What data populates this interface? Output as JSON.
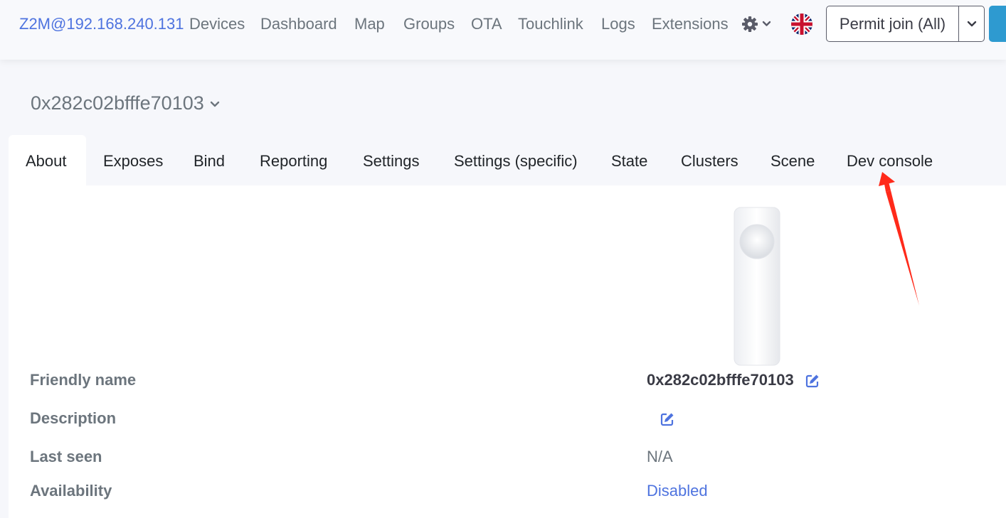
{
  "navbar": {
    "brand": "Z2M@192.168.240.131",
    "links": [
      "Devices",
      "Dashboard",
      "Map",
      "Groups",
      "OTA",
      "Touchlink",
      "Logs",
      "Extensions"
    ],
    "settings_icon": "gear-icon",
    "language_icon": "uk-flag-icon",
    "permit_join_label": "Permit join (All)",
    "brand_color": "#4e73df"
  },
  "device": {
    "title": "0x282c02bfffe70103"
  },
  "tabs": [
    "About",
    "Exposes",
    "Bind",
    "Reporting",
    "Settings",
    "Settings (specific)",
    "State",
    "Clusters",
    "Scene",
    "Dev console"
  ],
  "active_tab": "About",
  "about": {
    "rows": [
      {
        "label": "Friendly name",
        "value": "0x282c02bfffe70103"
      },
      {
        "label": "Description",
        "value": ""
      },
      {
        "label": "Last seen",
        "value": "N/A"
      },
      {
        "label": "Availability",
        "value": "Disabled"
      }
    ]
  },
  "annotation": {
    "color": "#ff2a1a"
  }
}
